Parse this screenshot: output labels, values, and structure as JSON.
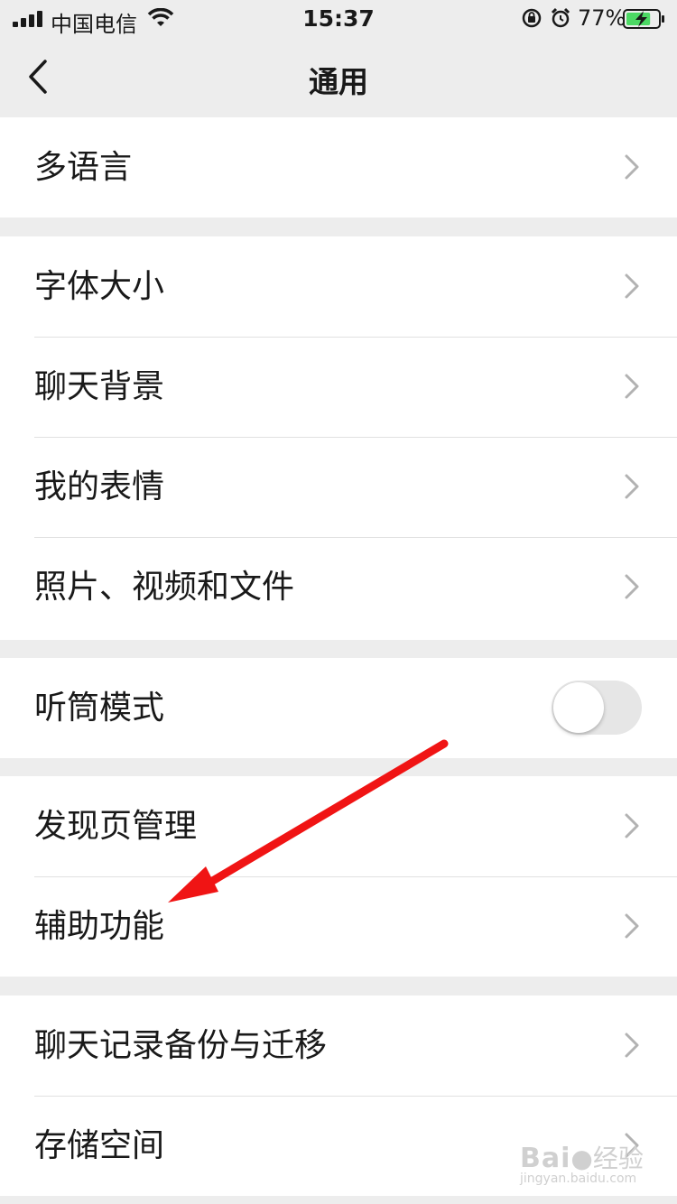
{
  "status_bar": {
    "carrier": "中国电信",
    "time": "15:37",
    "battery_percent": "77%",
    "battery_level": 0.77,
    "icons": [
      "signal-icon",
      "wifi-icon",
      "rotation-lock-icon",
      "alarm-icon",
      "battery-charging-icon"
    ]
  },
  "nav": {
    "title": "通用",
    "back_icon": "chevron-left-icon"
  },
  "groups": [
    {
      "items": [
        {
          "label": "多语言"
        }
      ]
    },
    {
      "items": [
        {
          "label": "字体大小"
        },
        {
          "label": "聊天背景"
        },
        {
          "label": "我的表情"
        },
        {
          "label": "照片、视频和文件"
        }
      ]
    },
    {
      "items": [
        {
          "label": "听筒模式",
          "toggle": false
        }
      ]
    },
    {
      "items": [
        {
          "label": "发现页管理"
        },
        {
          "label": "辅助功能"
        }
      ]
    },
    {
      "items": [
        {
          "label": "聊天记录备份与迁移"
        },
        {
          "label": "存储空间"
        }
      ]
    }
  ],
  "annotation": {
    "arrow_color": "#f01414"
  },
  "watermark": {
    "brand": "Bai",
    "brand2": "经验",
    "url": "jingyan.baidu.com"
  }
}
